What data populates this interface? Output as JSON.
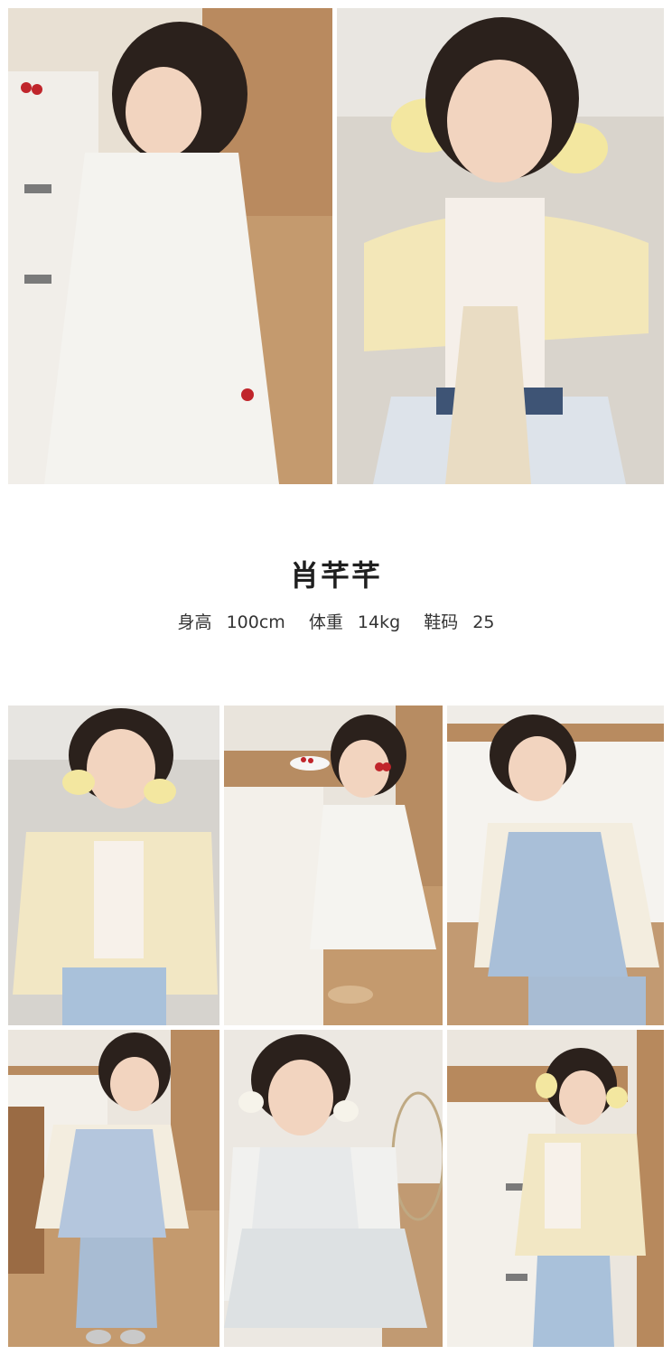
{
  "model": {
    "name": "肖芊芊",
    "stats": {
      "height_label": "身高",
      "height_value": "100cm",
      "weight_label": "体重",
      "weight_value": "14kg",
      "shoe_label": "鞋码",
      "shoe_value": "25"
    }
  },
  "photos": [
    {
      "id": "photo-white-tulle-dress-kitchen",
      "colors": {
        "bg": "#b98a5f",
        "wall": "#e8e0d3",
        "outfit": "#f4f3ef"
      }
    },
    {
      "id": "photo-yellow-raglan-tee-lace-skirt",
      "colors": {
        "bg": "#d9d4cc",
        "wall": "#e9e6e1",
        "outfit": "#f3e7b8"
      }
    },
    {
      "id": "photo-printed-jacket-sofa",
      "colors": {
        "bg": "#d6d3ce",
        "wall": "#e7e5e1",
        "outfit": "#f2e7c4"
      }
    },
    {
      "id": "photo-white-dress-cherries",
      "colors": {
        "bg": "#b78c62",
        "wall": "#e9e4dc",
        "outfit": "#f5f4f0"
      }
    },
    {
      "id": "photo-blue-crochet-vest",
      "colors": {
        "bg": "#e6e0d7",
        "wall": "#efece7",
        "outfit": "#a9bfd8"
      }
    },
    {
      "id": "photo-crochet-vest-flared-jeans",
      "colors": {
        "bg": "#b88b60",
        "wall": "#ebe6de",
        "outfit": "#b4c6dd"
      }
    },
    {
      "id": "photo-cami-tulle-dress",
      "colors": {
        "bg": "#c19a72",
        "wall": "#ece8e2",
        "outfit": "#e7e9ea"
      }
    },
    {
      "id": "photo-printed-jacket-kitchen",
      "colors": {
        "bg": "#b7895d",
        "wall": "#ebe6de",
        "outfit": "#f2e7c4"
      }
    }
  ]
}
